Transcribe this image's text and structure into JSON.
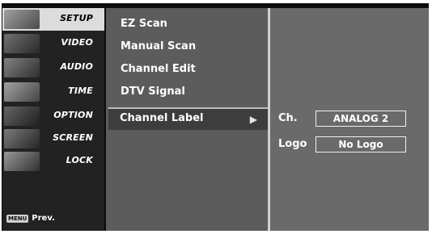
{
  "sidebar": {
    "items": [
      {
        "label": "SETUP",
        "active": true
      },
      {
        "label": "VIDEO",
        "active": false
      },
      {
        "label": "AUDIO",
        "active": false
      },
      {
        "label": "TIME",
        "active": false
      },
      {
        "label": "OPTION",
        "active": false
      },
      {
        "label": "SCREEN",
        "active": false
      },
      {
        "label": "LOCK",
        "active": false
      }
    ],
    "footer": {
      "menu_key": "MENU",
      "prev_label": "Prev."
    }
  },
  "menu": {
    "items": [
      {
        "label": "EZ Scan"
      },
      {
        "label": "Manual Scan"
      },
      {
        "label": "Channel Edit"
      },
      {
        "label": "DTV Signal"
      },
      {
        "label": "Channel Label"
      }
    ],
    "selected_index": 4
  },
  "submenu": {
    "channel_label": "Ch.",
    "channel_value": "ANALOG  2",
    "logo_label": "Logo",
    "logo_value": "No Logo"
  }
}
